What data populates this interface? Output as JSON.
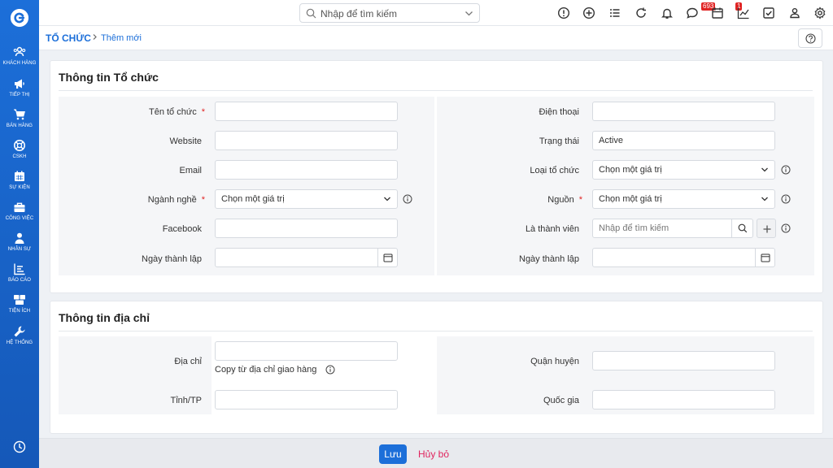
{
  "app": {
    "logo_icon": "brand-logo-icon"
  },
  "sidebar": {
    "items": [
      {
        "label": "KHÁCH HÀNG",
        "icon": "customers-icon"
      },
      {
        "label": "TIẾP THỊ",
        "icon": "megaphone-icon"
      },
      {
        "label": "BÁN HÀNG",
        "icon": "cart-icon"
      },
      {
        "label": "CSKH",
        "icon": "lifebuoy-icon"
      },
      {
        "label": "SỰ KIỆN",
        "icon": "calendar-icon"
      },
      {
        "label": "CÔNG VIỆC",
        "icon": "briefcase-icon"
      },
      {
        "label": "NHÂN SỰ",
        "icon": "person-icon"
      },
      {
        "label": "BÁO CÁO",
        "icon": "report-icon"
      },
      {
        "label": "TIỆN ÍCH",
        "icon": "boxes-icon"
      },
      {
        "label": "HỆ THỐNG",
        "icon": "wrench-icon"
      }
    ],
    "bottom_icon": "clock-icon"
  },
  "topbar": {
    "search_placeholder": "Nhập để tìm kiếm",
    "notification_count": "693",
    "chat_count": "1"
  },
  "breadcrumb": {
    "module": "TỔ CHỨC",
    "page": "Thêm mới"
  },
  "org_info": {
    "title": "Thông tin Tổ chức",
    "left": {
      "name_label": "Tên tổ chức",
      "website_label": "Website",
      "email_label": "Email",
      "industry_label": "Ngành nghề",
      "industry_value": "Chọn một giá trị",
      "facebook_label": "Facebook",
      "founded_label": "Ngày thành lập"
    },
    "right": {
      "phone_label": "Điện thoại",
      "status_label": "Trạng thái",
      "status_value": "Active",
      "type_label": "Loại tổ chức",
      "type_value": "Chọn một giá trị",
      "source_label": "Nguồn",
      "source_value": "Chọn một giá trị",
      "member_label": "Là thành viên",
      "member_placeholder": "Nhập để tìm kiếm",
      "founded_label": "Ngày thành lập"
    },
    "required_mark": "*"
  },
  "address_info": {
    "title": "Thông tin địa chỉ",
    "address_label": "Địa chỉ",
    "copy_label": "Copy từ địa chỉ giao hàng",
    "province_label": "Tỉnh/TP",
    "district_label": "Quận huyện",
    "country_label": "Quốc gia"
  },
  "footer": {
    "save_label": "Lưu",
    "cancel_label": "Hủy bỏ"
  },
  "colors": {
    "primary": "#1c6fd9",
    "danger": "#e02424",
    "cancel": "#e0245e"
  }
}
